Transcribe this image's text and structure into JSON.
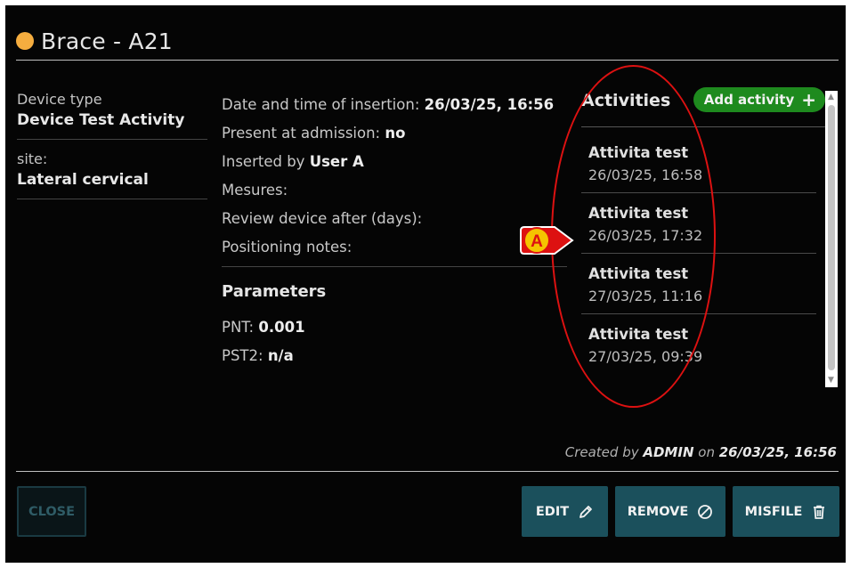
{
  "header": {
    "title": "Brace - A21",
    "status_color": "#f5ad3f"
  },
  "device": {
    "type_label": "Device type",
    "type_value": "Device Test Activity",
    "site_label": "site:",
    "site_value": "Lateral cervical"
  },
  "details": {
    "insertion_label": "Date and time of insertion:",
    "insertion_value": "26/03/25, 16:56",
    "admission_label": "Present at admission:",
    "admission_value": "no",
    "inserted_by_label": "Inserted by",
    "inserted_by_value": "User A",
    "mesures_label": "Mesures:",
    "review_label": "Review device after (days):",
    "positioning_label": "Positioning notes:"
  },
  "parameters": {
    "title": "Parameters",
    "items": [
      {
        "label": "PNT:",
        "value": "0.001"
      },
      {
        "label": "PST2:",
        "value": "n/a"
      }
    ]
  },
  "activities": {
    "title": "Activities",
    "add_label": "Add activity",
    "items": [
      {
        "name": "Attivita test",
        "date": "26/03/25, 16:58"
      },
      {
        "name": "Attivita test",
        "date": "26/03/25, 17:32"
      },
      {
        "name": "Attivita test",
        "date": "27/03/25, 11:16"
      },
      {
        "name": "Attivita test",
        "date": "27/03/25, 09:39"
      }
    ]
  },
  "annotation": {
    "callout_letter": "A",
    "color": "#dd1111"
  },
  "footer": {
    "created_prefix": "Created by",
    "created_user": "ADMIN",
    "created_on": "on",
    "created_date": "26/03/25, 16:56"
  },
  "buttons": {
    "close": "CLOSE",
    "edit": "EDIT",
    "remove": "REMOVE",
    "misfile": "MISFILE",
    "primary_color": "#1b505c"
  }
}
